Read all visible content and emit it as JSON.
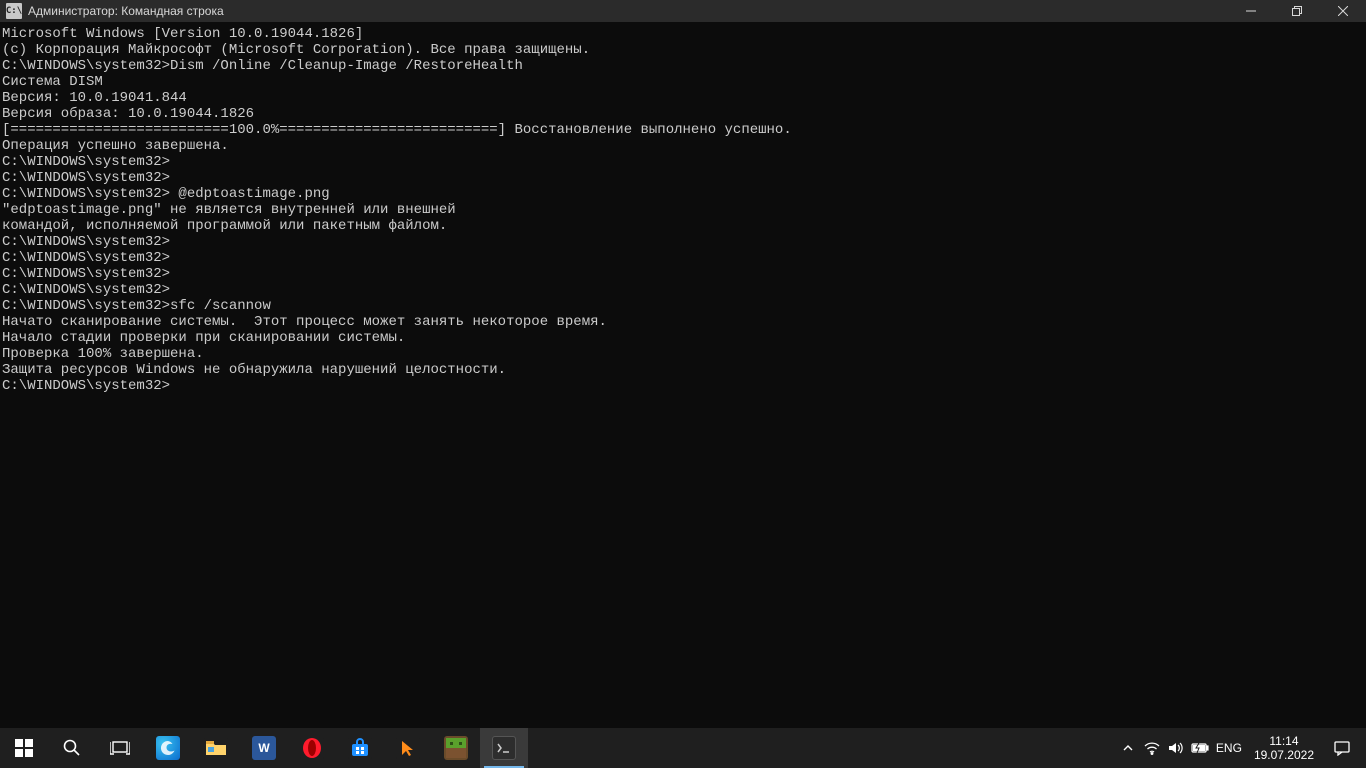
{
  "window": {
    "icon_text": "C:\\",
    "title": "Администратор: Командная строка"
  },
  "terminal": {
    "lines": [
      "Microsoft Windows [Version 10.0.19044.1826]",
      "(c) Корпорация Майкрософт (Microsoft Corporation). Все права защищены.",
      "",
      "C:\\WINDOWS\\system32>Dism /Online /Cleanup-Image /RestoreHealth",
      "",
      "Cистема DISM",
      "Версия: 10.0.19041.844",
      "",
      "Версия образа: 10.0.19044.1826",
      "",
      "[==========================100.0%==========================] Восстановление выполнено успешно.",
      "Операция успешно завершена.",
      "",
      "C:\\WINDOWS\\system32>",
      "C:\\WINDOWS\\system32>",
      "C:\\WINDOWS\\system32> @edptoastimage.png",
      "\"edptoastimage.png\" не является внутренней или внешней",
      "командой, исполняемой программой или пакетным файлом.",
      "",
      "C:\\WINDOWS\\system32>",
      "C:\\WINDOWS\\system32>",
      "C:\\WINDOWS\\system32>",
      "C:\\WINDOWS\\system32>",
      "C:\\WINDOWS\\system32>sfc /scannow",
      "",
      "Начато сканирование системы.  Этот процесс может занять некоторое время.",
      "",
      "Начало стадии проверки при сканировании системы.",
      "Проверка 100% завершена.",
      "",
      "Защита ресурсов Windows не обнаружила нарушений целостности.",
      "",
      "C:\\WINDOWS\\system32>"
    ]
  },
  "taskbar": {
    "lang": "ENG",
    "time": "11:14",
    "date": "19.07.2022"
  }
}
